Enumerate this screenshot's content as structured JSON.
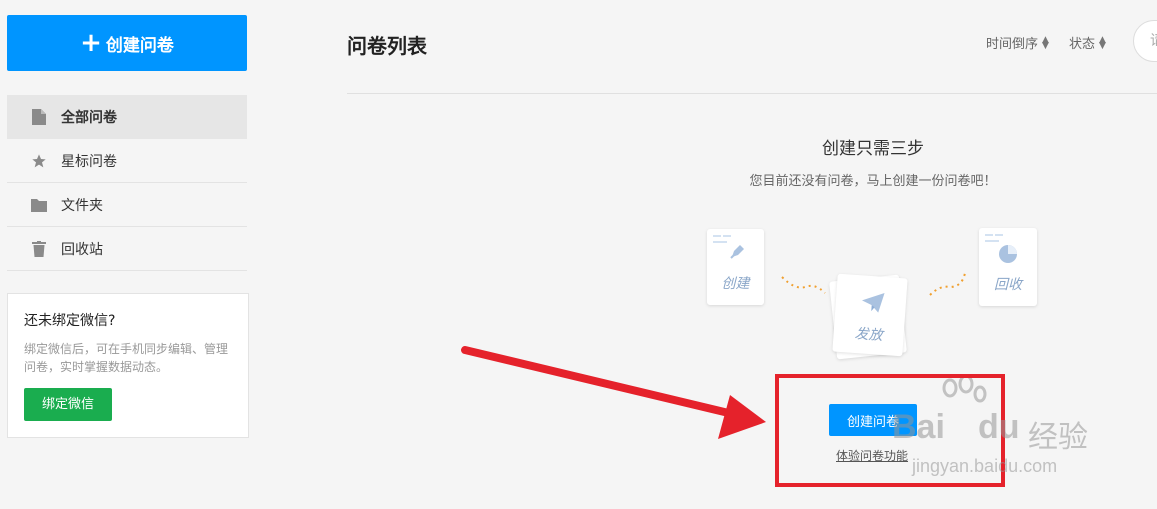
{
  "sidebar": {
    "create_label": "创建问卷",
    "nav": [
      {
        "label": "全部问卷",
        "icon": "document-icon",
        "active": true
      },
      {
        "label": "星标问卷",
        "icon": "star-icon",
        "active": false
      },
      {
        "label": "文件夹",
        "icon": "folder-icon",
        "active": false
      },
      {
        "label": "回收站",
        "icon": "trash-icon",
        "active": false
      }
    ],
    "wechat": {
      "title": "还未绑定微信?",
      "desc": "绑定微信后，可在手机同步编辑、管理问卷，实时掌握数据动态。",
      "button": "绑定微信"
    }
  },
  "main": {
    "title": "问卷列表",
    "sort_time": "时间倒序",
    "sort_status": "状态",
    "search_placeholder": "请",
    "empty_title": "创建只需三步",
    "empty_sub": "您目前还没有问卷，马上创建一份问卷吧！",
    "steps": [
      "创建",
      "发放",
      "回收"
    ],
    "create_button": "创建问卷",
    "try_link": "体验问卷功能"
  },
  "watermark": {
    "brand": "Bai",
    "brand2": "du",
    "product": "经验",
    "url": "jingyan.baidu.com"
  },
  "colors": {
    "primary": "#0095ff",
    "wechat_green": "#1aad4f",
    "annotation_red": "#e5222b"
  }
}
